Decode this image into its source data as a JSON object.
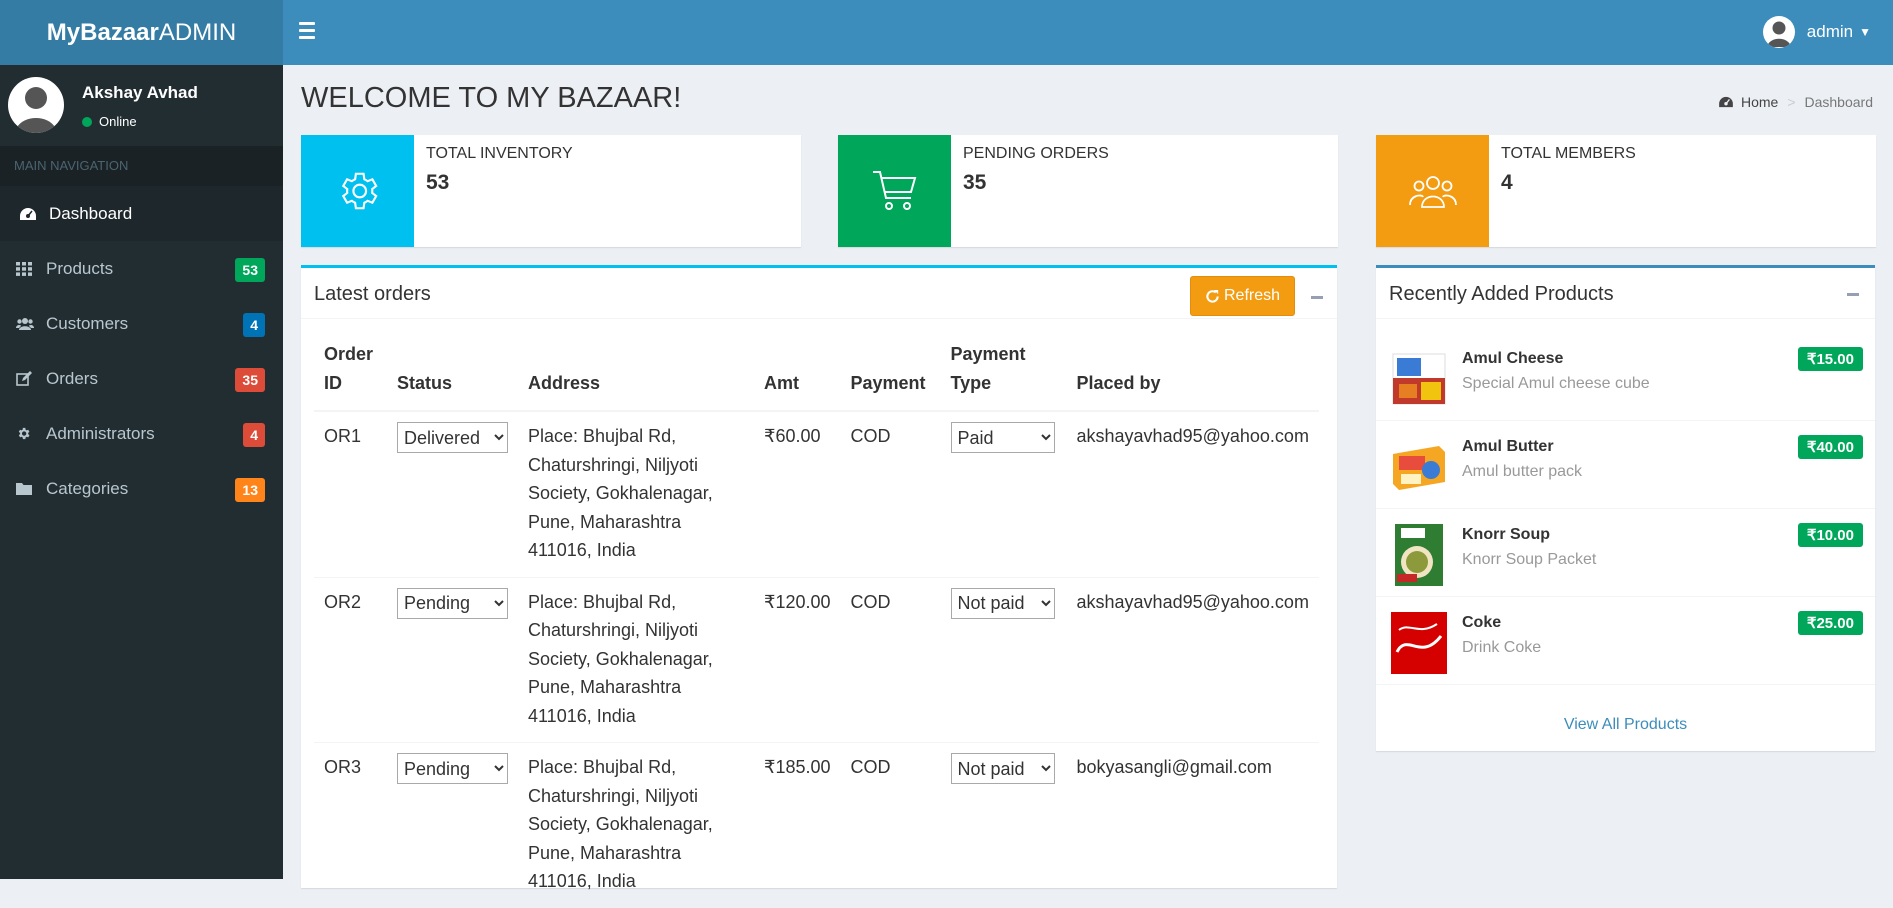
{
  "brand": {
    "bold": "MyBazaar",
    "light": "ADMIN"
  },
  "header": {
    "user_name": "admin"
  },
  "sidebar": {
    "user_name": "Akshay Avhad",
    "status": "Online",
    "nav_header": "MAIN NAVIGATION",
    "items": [
      {
        "label": "Dashboard",
        "icon": "dashboard-icon",
        "badge": null
      },
      {
        "label": "Products",
        "icon": "grid-icon",
        "badge": "53",
        "badge_color": "#00a65a"
      },
      {
        "label": "Customers",
        "icon": "users-icon",
        "badge": "4",
        "badge_color": "#0073b7"
      },
      {
        "label": "Orders",
        "icon": "edit-icon",
        "badge": "35",
        "badge_color": "#dd4b39"
      },
      {
        "label": "Administrators",
        "icon": "gear-icon",
        "badge": "4",
        "badge_color": "#dd4b39"
      },
      {
        "label": "Categories",
        "icon": "folder-icon",
        "badge": "13",
        "badge_color": "#ff851b"
      }
    ]
  },
  "page": {
    "title": "WELCOME TO MY BAZAAR!"
  },
  "breadcrumb": {
    "home": "Home",
    "current": "Dashboard"
  },
  "info_boxes": [
    {
      "label": "TOTAL INVENTORY",
      "value": "53",
      "color": "#00c0ef",
      "icon": "gear-icon"
    },
    {
      "label": "PENDING ORDERS",
      "value": "35",
      "color": "#00a65a",
      "icon": "cart-icon"
    },
    {
      "label": "TOTAL MEMBERS",
      "value": "4",
      "color": "#f39c12",
      "icon": "users-icon"
    }
  ],
  "orders": {
    "title": "Latest orders",
    "refresh_label": "Refresh",
    "columns": [
      "Order ID",
      "Status",
      "Address",
      "Amt",
      "Payment",
      "Payment Type",
      "Placed by"
    ],
    "rows": [
      {
        "id": "OR1",
        "status": "Delivered",
        "address": "Place: Bhujbal Rd, Chatursh­ringi, Niljyoti Society, Gokhalenagar, Pune, Maharashtra 411016, India",
        "amt": "₹60.00",
        "payment": "COD",
        "payment_type": "Paid",
        "placed_by": "akshayavhad95@yahoo.com"
      },
      {
        "id": "OR2",
        "status": "Pending",
        "address": "Place: Bhujbal Rd, Chatursh­ringi, Niljyoti Society, Gokhalenagar, Pune, Maharashtra 411016, India",
        "amt": "₹120.00",
        "payment": "COD",
        "payment_type": "Not paid",
        "placed_by": "akshayavhad95@yahoo.com"
      },
      {
        "id": "OR3",
        "status": "Pending",
        "address": "Place: Bhujbal Rd, Chatursh­ringi, Niljyoti Society, Gokhalenagar, Pune, Maharashtra 411016, India",
        "amt": "₹185.00",
        "payment": "COD",
        "payment_type": "Not paid",
        "placed_by": "bokyasangli@gmail.com"
      }
    ]
  },
  "recent": {
    "title": "Recently Added Products",
    "view_all": "View All Products",
    "products": [
      {
        "name": "Amul Cheese",
        "desc": "Special Amul cheese cube",
        "price": "₹15.00"
      },
      {
        "name": "Amul Butter",
        "desc": "Amul butter pack",
        "price": "₹40.00"
      },
      {
        "name": "Knorr Soup",
        "desc": "Knorr Soup Packet",
        "price": "₹10.00"
      },
      {
        "name": "Coke",
        "desc": "Drink Coke",
        "price": "₹25.00"
      }
    ]
  }
}
